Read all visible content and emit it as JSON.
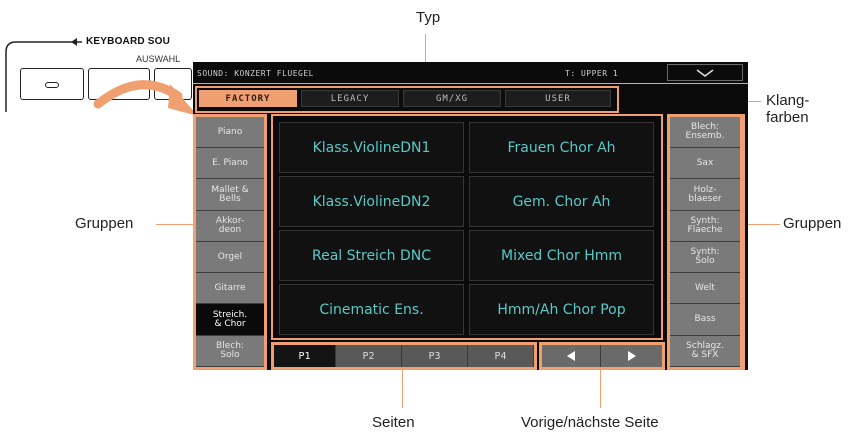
{
  "callouts": {
    "type": "Typ",
    "sounds": "Klang-\nfarben",
    "groups_left": "Gruppen",
    "groups_right": "Gruppen",
    "pages": "Seiten",
    "prev_next": "Vorige/nächste Seite"
  },
  "keyboard_panel": {
    "title": "KEYBOARD SOU",
    "subtitle": "AUSWAHL"
  },
  "screen": {
    "sound_label": "SOUND: KONZERT FLUEGEL",
    "track_label": "T: UPPER 1",
    "menu_icon": "chevron-down-icon",
    "tabs": [
      {
        "label": "FACTORY",
        "active": true
      },
      {
        "label": "LEGACY",
        "active": false
      },
      {
        "label": "GM/XG",
        "active": false
      },
      {
        "label": "USER",
        "active": false
      }
    ],
    "left_groups": [
      {
        "label": "Piano",
        "active": false
      },
      {
        "label": "E. Piano",
        "active": false
      },
      {
        "label": "Mallet &\nBells",
        "active": false
      },
      {
        "label": "Akkor-\ndeon",
        "active": false
      },
      {
        "label": "Orgel",
        "active": false
      },
      {
        "label": "Gitarre",
        "active": false
      },
      {
        "label": "Streich.\n& Chor",
        "active": true
      },
      {
        "label": "Blech:\nSolo",
        "active": false
      }
    ],
    "right_groups": [
      {
        "label": "Blech:\nEnsemb.",
        "active": false
      },
      {
        "label": "Sax",
        "active": false
      },
      {
        "label": "Holz-\nblaeser",
        "active": false
      },
      {
        "label": "Synth:\nFlaeche",
        "active": false
      },
      {
        "label": "Synth:\nSolo",
        "active": false
      },
      {
        "label": "Welt",
        "active": false
      },
      {
        "label": "Bass",
        "active": false
      },
      {
        "label": "Schlagz.\n& SFX",
        "active": false
      }
    ],
    "sounds": [
      "Klass.ViolineDN1",
      "Frauen Chor Ah",
      "Klass.ViolineDN2",
      "Gem. Chor Ah",
      "Real Streich DNC",
      "Mixed Chor Hmm",
      "Cinematic Ens.",
      "Hmm/Ah Chor Pop"
    ],
    "pages": [
      {
        "label": "P1",
        "active": true
      },
      {
        "label": "P2",
        "active": false
      },
      {
        "label": "P3",
        "active": false
      },
      {
        "label": "P4",
        "active": false
      }
    ],
    "prev_icon": "triangle-left-icon",
    "next_icon": "triangle-right-icon"
  },
  "colors": {
    "accent": "#f0a070",
    "sound_text": "#59c9c6",
    "group_bg": "#7a7a7a",
    "screen_bg": "#0b0b0b"
  }
}
